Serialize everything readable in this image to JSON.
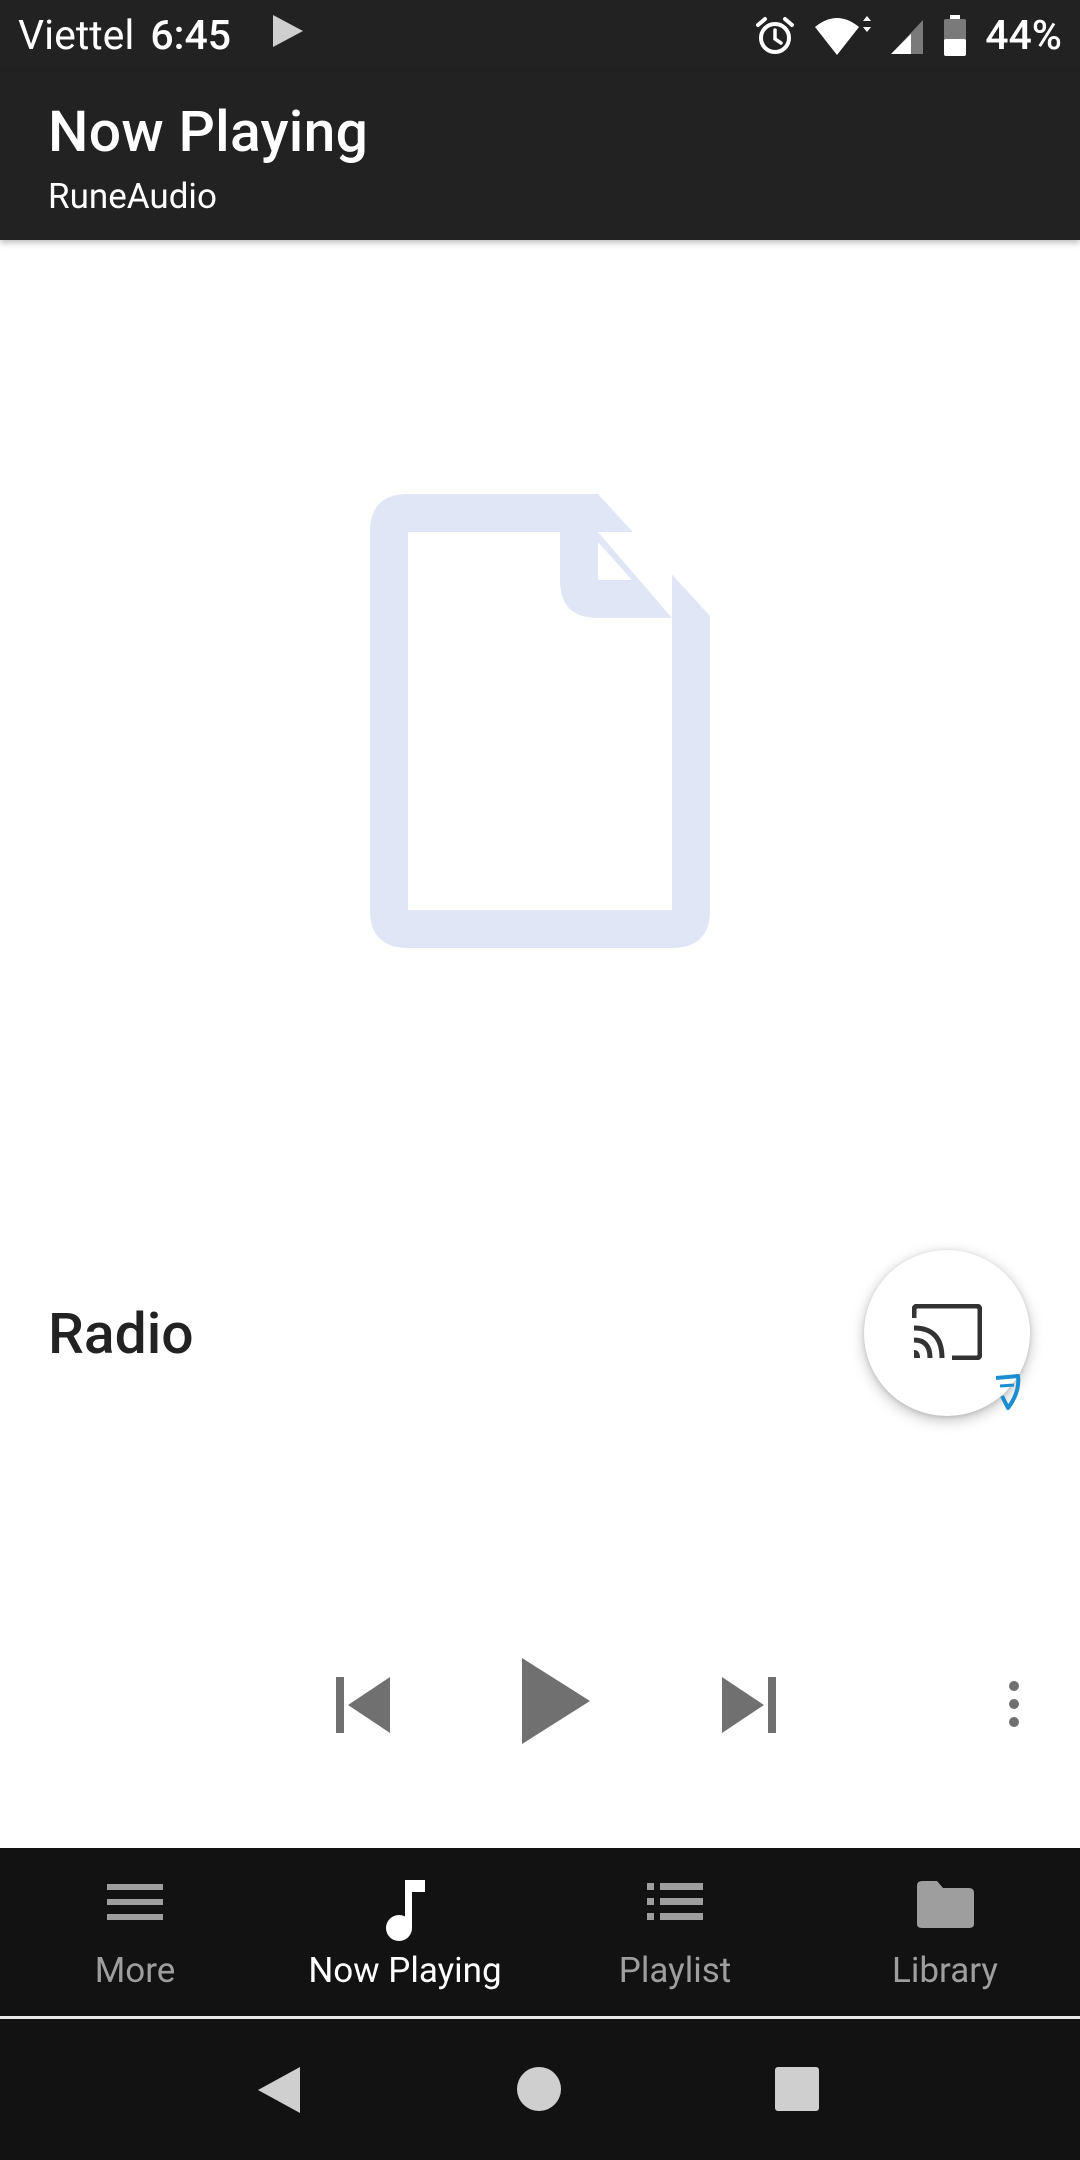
{
  "status_bar": {
    "carrier": "Viettel",
    "time": "6:45",
    "battery_percent": "44%",
    "battery_level": 0.44,
    "icons": [
      "play-icon",
      "alarm-icon",
      "wifi-icon",
      "signal-icon",
      "battery-icon"
    ]
  },
  "app_bar": {
    "title": "Now Playing",
    "subtitle": "RuneAudio"
  },
  "now_playing": {
    "album_art_icon": "file-icon",
    "track_title": "Radio"
  },
  "cast_button": {
    "icon": "cast-icon",
    "badge_icon": "shield-icon"
  },
  "controls": {
    "previous_icon": "skip-previous-icon",
    "play_icon": "play-icon",
    "next_icon": "skip-next-icon",
    "overflow_icon": "more-vert-icon"
  },
  "bottom_nav": {
    "active": "Now Playing",
    "items": [
      {
        "label": "More",
        "icon": "menu-icon"
      },
      {
        "label": "Now Playing",
        "icon": "music-note-icon"
      },
      {
        "label": "Playlist",
        "icon": "list-icon"
      },
      {
        "label": "Library",
        "icon": "folder-icon"
      }
    ]
  },
  "colors": {
    "app_bar": "#222222",
    "bottom_nav": "#121212",
    "album_art_placeholder": "#e0e6f6",
    "control_icons": "#707070",
    "nav_inactive": "#9e9e9e",
    "nav_active": "#ffffff",
    "badge_accent": "#1b8ed1"
  }
}
